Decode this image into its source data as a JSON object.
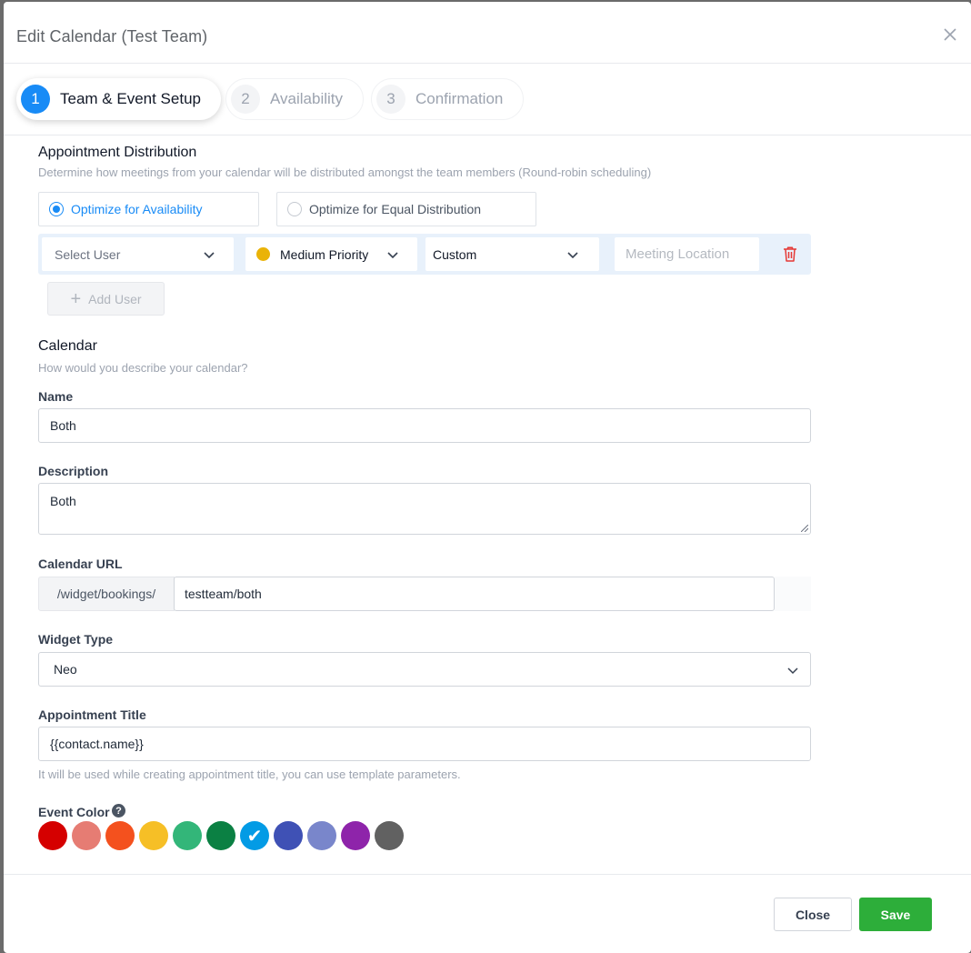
{
  "modal": {
    "title": "Edit Calendar (Test Team)"
  },
  "steps": [
    {
      "number": "1",
      "label": "Team & Event Setup",
      "active": true
    },
    {
      "number": "2",
      "label": "Availability",
      "active": false
    },
    {
      "number": "3",
      "label": "Confirmation",
      "active": false
    }
  ],
  "distribution": {
    "title": "Appointment Distribution",
    "subtitle": "Determine how meetings from your calendar will be distributed amongst the team members (Round-robin scheduling)",
    "options": [
      {
        "label": "Optimize for Availability",
        "selected": true
      },
      {
        "label": "Optimize for Equal Distribution",
        "selected": false
      }
    ],
    "user_row": {
      "user_placeholder": "Select User",
      "priority": "Medium Priority",
      "priority_color": "#eab308",
      "location_type": "Custom",
      "location_placeholder": "Meeting Location"
    },
    "add_user_label": "Add User"
  },
  "calendar": {
    "title": "Calendar",
    "subtitle": "How would you describe your calendar?",
    "name_label": "Name",
    "name_value": "Both",
    "description_label": "Description",
    "description_value": "Both",
    "url_label": "Calendar URL",
    "url_prefix": "/widget/bookings/",
    "url_value": "testteam/both",
    "widget_label": "Widget Type",
    "widget_value": "Neo",
    "appt_title_label": "Appointment Title",
    "appt_title_value": "{{contact.name}}",
    "appt_title_hint": "It will be used while creating appointment title, you can use template parameters.",
    "event_color_label": "Event Color",
    "colors": [
      "#d50000",
      "#e67c73",
      "#f4511e",
      "#f6bf26",
      "#33b679",
      "#0b8043",
      "#039be5",
      "#3f51b5",
      "#7986cb",
      "#8e24aa",
      "#616161"
    ],
    "selected_color_index": 6
  },
  "footer": {
    "close_label": "Close",
    "save_label": "Save"
  }
}
